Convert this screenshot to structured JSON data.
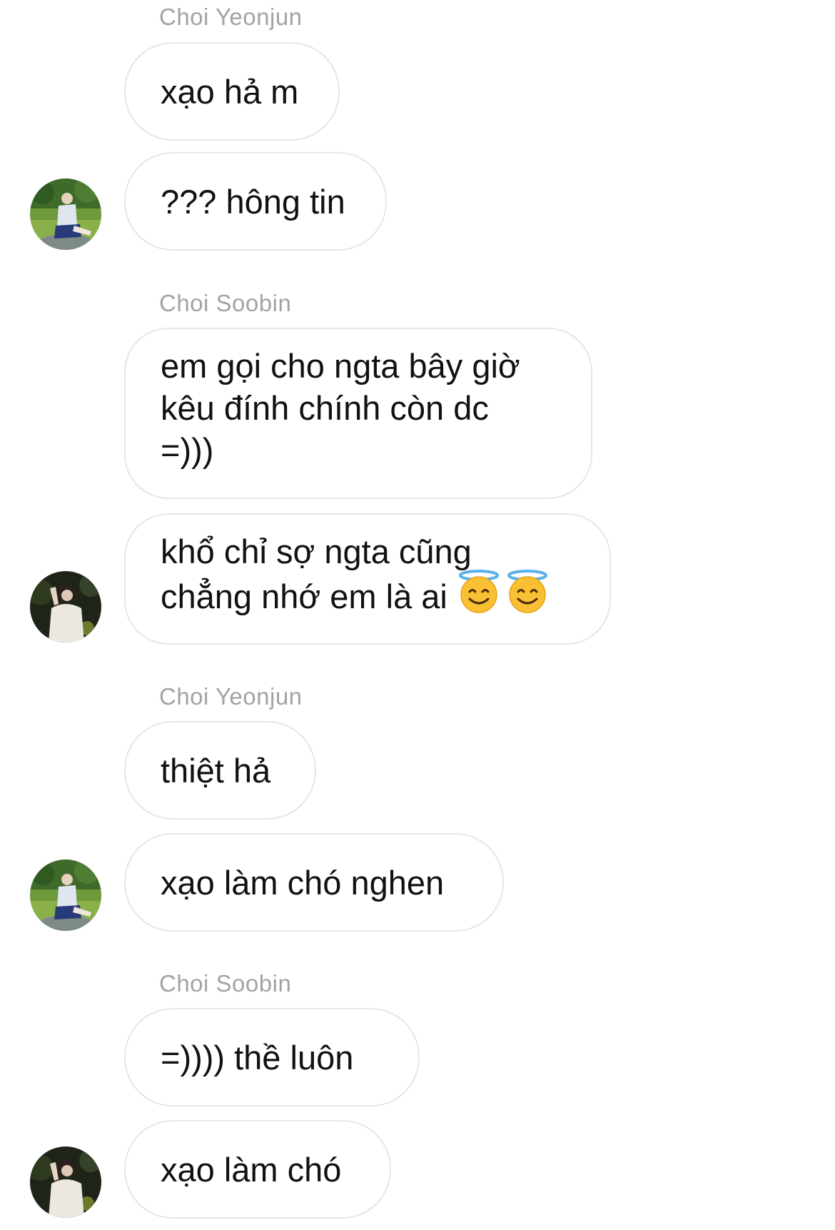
{
  "thread": {
    "groups": [
      {
        "sender": "Choi Yeonjun",
        "messages": [
          "xạo hả m",
          "??? hông tin"
        ]
      },
      {
        "sender": "Choi Soobin",
        "messages": [
          "em gọi cho ngta bây giờ\nkêu đính chính còn dc\n=)))",
          "khổ chỉ sợ ngta cũng\nchẳng nhớ em là ai"
        ],
        "emoji": [
          "smiling-face-with-halo-icon",
          "smiling-face-with-halo-icon"
        ]
      },
      {
        "sender": "Choi Yeonjun",
        "messages": [
          "thiệt hả",
          "xạo làm chó nghen"
        ]
      },
      {
        "sender": "Choi Soobin",
        "messages": [
          "=)))) thề luôn",
          "xạo làm chó"
        ]
      }
    ]
  },
  "colors": {
    "sender_name": "#a3a3a3",
    "bubble_border": "#e6e6e6",
    "message_text": "#111111",
    "background": "#ffffff"
  }
}
